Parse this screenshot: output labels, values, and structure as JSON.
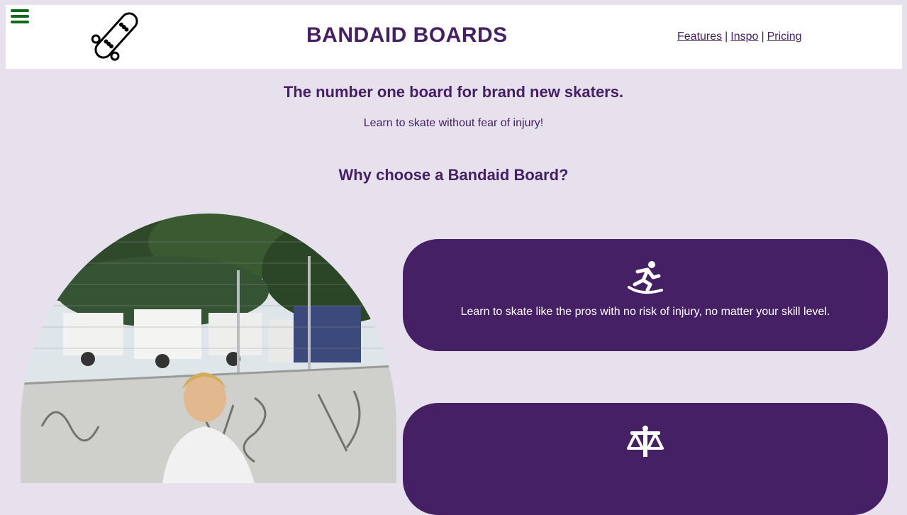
{
  "header": {
    "brand": "BANDAID BOARDS",
    "menu_icon": "hamburger-menu-icon",
    "logo_icon": "skateboard-icon",
    "nav": [
      {
        "label": "Features"
      },
      {
        "label": "Inspo"
      },
      {
        "label": "Pricing"
      }
    ],
    "nav_separator": "|"
  },
  "hero": {
    "headline": "The number one board for brand new skaters.",
    "subline": "Learn to skate without fear of injury!"
  },
  "features": {
    "heading": "Why choose a Bandaid Board?",
    "cards": [
      {
        "icon": "skater-icon",
        "text": "Learn to skate like the pros with no risk of injury, no matter your skill level."
      },
      {
        "icon": "balance-scale-icon",
        "text": ""
      }
    ]
  },
  "colors": {
    "primary": "#452064",
    "background": "#e6e1ec",
    "menu_icon": "#0f6b1c"
  }
}
